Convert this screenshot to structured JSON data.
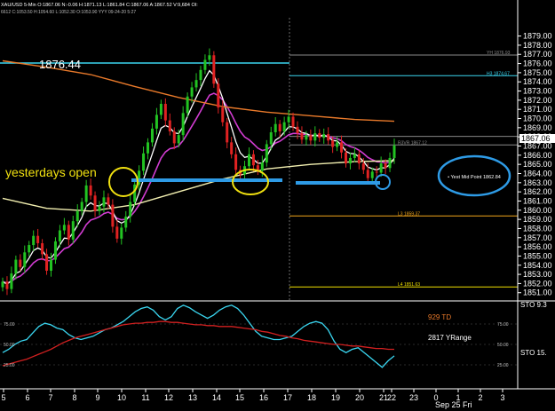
{
  "header": {
    "symbol_line": "XAU/USD 5-Min  O:1867.06  N:-0.06  H:1871.13  L:1861.84  C:1867.06  A:1867.52  V:9,684  OI:",
    "sub_line": "6612  C:1053.50  H:1054.60  L:1052.30  O:1053.90  YYY 09-24-20  5:27"
  },
  "colors": {
    "background": "#000000",
    "price": "#ffffff",
    "up_bar": "#22c322",
    "down_bar": "#e02222",
    "ma_white": "#ffffff",
    "ma_magenta": "#d23cd2",
    "ma_orange": "#e8792a",
    "ma_yellow": "#f2efb0",
    "annotation_blue": "#2e9be6",
    "annotation_yellow": "#f0e010",
    "level_cyan": "#3ad6f0",
    "level_yellow": "#f0e000",
    "level_orange": "#f2a51a",
    "osc_cyan": "#3ad6f0",
    "osc_red": "#d22020"
  },
  "chart_data": [
    {
      "type": "candlestick",
      "title": "XAU/USD 5-Min",
      "x_ticks": [
        "5",
        "6",
        "7",
        "8",
        "9",
        "10",
        "11",
        "12",
        "13",
        "14",
        "15",
        "16",
        "17",
        "18",
        "19",
        "20",
        "21",
        "22",
        "23",
        "0",
        "1",
        "2",
        "3"
      ],
      "x_footer": "Sep 25 Fri",
      "y_ticks": [
        1851,
        1852,
        1853,
        1854,
        1855,
        1856,
        1857,
        1858,
        1859,
        1860,
        1861,
        1862,
        1863,
        1864,
        1865,
        1866,
        1867,
        1868,
        1869,
        1870,
        1871,
        1872,
        1873,
        1874,
        1875,
        1876,
        1877,
        1878,
        1879
      ],
      "ylim": [
        1850.2,
        1880.8
      ],
      "last_price": "1867.06",
      "big_label": "1876.44",
      "annotation": "yesterdays open",
      "callout": "Yest Mid Point 1862.84",
      "levels": [
        {
          "name": "YH 1876.93",
          "value": 1876.93,
          "color": "#8a8a8a"
        },
        {
          "name": "H3 1874.67",
          "value": 1874.67,
          "color": "#3ad6f0"
        },
        {
          "name": "R3VR 1867.12",
          "value": 1867.12,
          "color": "#8a8a8a"
        },
        {
          "name": "L3 1859.37",
          "value": 1859.37,
          "color": "#f2a51a"
        },
        {
          "name": "L4 1851.63",
          "value": 1851.63,
          "color": "#f0e000"
        }
      ],
      "closes": [
        1852.2,
        1851.4,
        1853.1,
        1854.6,
        1853.8,
        1855.4,
        1856.2,
        1857.2,
        1856.4,
        1855.2,
        1853.4,
        1854.6,
        1856.6,
        1857.8,
        1858.4,
        1856.8,
        1858.8,
        1859.9,
        1860.9,
        1862.7,
        1861.6,
        1859.9,
        1860.4,
        1861.4,
        1860.6,
        1858.2,
        1856.9,
        1858.1,
        1859.3,
        1860.9,
        1862.8,
        1864.3,
        1866.2,
        1867.4,
        1868.9,
        1870.4,
        1871.6,
        1869.8,
        1868.6,
        1867.3,
        1868.2,
        1870.6,
        1872.4,
        1873.4,
        1874.2,
        1875.3,
        1876.4,
        1876.9,
        1873.8,
        1871.2,
        1869.6,
        1867.4,
        1866.1,
        1864.4,
        1863.9,
        1864.8,
        1866.1,
        1864.9,
        1864.3,
        1865.2,
        1867.2,
        1868.5,
        1869.4,
        1868.6,
        1869.6,
        1870.2,
        1869.1,
        1868.4,
        1867.7,
        1868.2,
        1867.6,
        1868.4,
        1867.9,
        1868.3,
        1867.6,
        1866.9,
        1867.4,
        1866.3,
        1865.1,
        1865.7,
        1866.1,
        1865.1,
        1864.4,
        1863.5,
        1864.2,
        1864.1,
        1865.1,
        1864.6,
        1865.7,
        1867.06
      ]
    },
    {
      "type": "line",
      "title": "STO",
      "y_ticks": [
        "25.00",
        "50.00",
        "75.00"
      ],
      "ylim": [
        0,
        100
      ],
      "labels": [
        "929 TD",
        "2817 YRange"
      ],
      "right_labels": [
        "STO 9.3",
        "STO 15."
      ],
      "series": [
        {
          "name": "STO 9.3",
          "values": [
            40,
            44,
            50,
            54,
            56,
            64,
            72,
            76,
            74,
            70,
            68,
            62,
            58,
            56,
            58,
            60,
            64,
            68,
            70,
            74,
            78,
            84,
            90,
            94,
            96,
            92,
            84,
            80,
            84,
            94,
            98,
            95,
            90,
            86,
            82,
            86,
            92,
            96,
            98,
            94,
            86,
            76,
            66,
            60,
            58,
            56,
            56,
            58,
            60,
            66,
            72,
            76,
            78,
            76,
            68,
            54,
            44,
            40,
            44,
            46,
            40,
            34,
            28,
            22,
            30,
            36
          ]
        },
        {
          "name": "STO 15.",
          "values": [
            24,
            26,
            28,
            30,
            32,
            35,
            38,
            41,
            44,
            48,
            52,
            55,
            58,
            60,
            62,
            64,
            66,
            68,
            70,
            72,
            74,
            75,
            76,
            76,
            77,
            77,
            78,
            78,
            77,
            77,
            76,
            75,
            74,
            74,
            73,
            73,
            72,
            72,
            72,
            71,
            70,
            69,
            68,
            66,
            65,
            63,
            61,
            60,
            58,
            57,
            55,
            54,
            53,
            52,
            51,
            50,
            50,
            49,
            48,
            48,
            47,
            46,
            45,
            45,
            44,
            44
          ]
        }
      ]
    }
  ]
}
